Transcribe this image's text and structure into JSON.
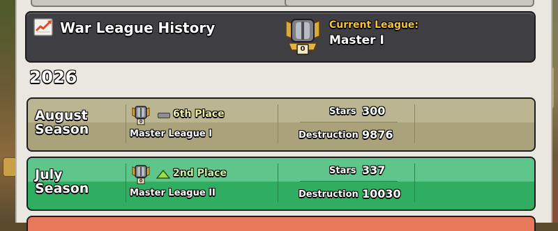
{
  "header": {
    "title": "War League History",
    "current_league_label": "Current League:",
    "current_league_value": "Master I",
    "badge_number": "0"
  },
  "year": "2026",
  "seasons": [
    {
      "name_line1": "August",
      "name_line2": "Season",
      "badge_number": "0",
      "change": "neutral",
      "place": "6th Place",
      "league": "Master League I",
      "stars_label": "Stars",
      "stars": "300",
      "destruction_label": "Destruction",
      "destruction": "9876",
      "color": "#a9a27b"
    },
    {
      "name_line1": "July",
      "name_line2": "Season",
      "badge_number": "0",
      "change": "up",
      "place": "2nd Place",
      "league": "Master League II",
      "stars_label": "Stars",
      "stars": "337",
      "destruction_label": "Destruction",
      "destruction": "10030",
      "color": "#2fae61"
    }
  ],
  "colors": {
    "header_bg": "#3f3f43",
    "accent_yellow": "#f7c534",
    "place_neutral": "#eef0a0",
    "place_up": "#c9f3a5",
    "next_card": "#e8785a"
  }
}
